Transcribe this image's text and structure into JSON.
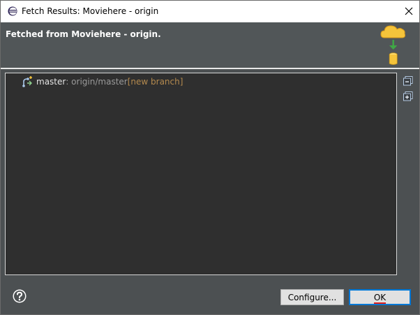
{
  "window": {
    "title": "Fetch Results: Moviehere - origin",
    "close_icon": "close-icon"
  },
  "banner": {
    "heading": "Fetched from Moviehere - origin.",
    "illustration_icon": "cloud-fetch-database-icon"
  },
  "results": [
    {
      "icon": "branch-update-icon",
      "local_ref": "master",
      "remote_ref": " : origin/master",
      "status": " [new branch]"
    }
  ],
  "side_tools": {
    "collapse_all_icon": "collapse-all-icon",
    "expand_all_icon": "expand-all-icon"
  },
  "footer": {
    "help_icon": "help-icon",
    "configure_label": "Configure...",
    "ok_label": "OK"
  },
  "colors": {
    "dialog_bg": "#4c5052",
    "banner_bg": "#515658",
    "tree_bg": "#2f2f2f",
    "remote_ref_text": "#9a9a9a",
    "status_text": "#b48a4e",
    "ok_border": "#0078d7"
  }
}
